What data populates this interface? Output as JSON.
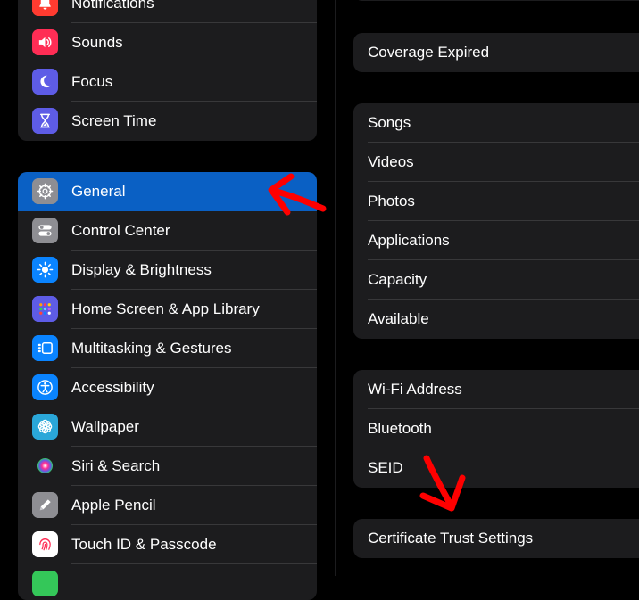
{
  "sidebar": {
    "group1": [
      {
        "label": "Notifications",
        "icon": "bell-icon",
        "color": "#ff3b30"
      },
      {
        "label": "Sounds",
        "icon": "speaker-icon",
        "color": "#ff2d55"
      },
      {
        "label": "Focus",
        "icon": "moon-icon",
        "color": "#5e5ce6"
      },
      {
        "label": "Screen Time",
        "icon": "hourglass-icon",
        "color": "#5e5ce6"
      }
    ],
    "group2": [
      {
        "label": "General",
        "icon": "gear-icon",
        "color": "#8e8e93",
        "selected": true
      },
      {
        "label": "Control Center",
        "icon": "toggles-icon",
        "color": "#8e8e93"
      },
      {
        "label": "Display & Brightness",
        "icon": "sun-icon",
        "color": "#0a84ff"
      },
      {
        "label": "Home Screen & App Library",
        "icon": "grid-icon",
        "color": "#5e5ce6"
      },
      {
        "label": "Multitasking & Gestures",
        "icon": "multitasking-icon",
        "color": "#0a84ff"
      },
      {
        "label": "Accessibility",
        "icon": "accessibility-icon",
        "color": "#0a84ff"
      },
      {
        "label": "Wallpaper",
        "icon": "flower-icon",
        "color": "#2aa7d9"
      },
      {
        "label": "Siri & Search",
        "icon": "siri-icon",
        "color": "#1c1c1e"
      },
      {
        "label": "Apple Pencil",
        "icon": "pencil-icon",
        "color": "#8e8e93"
      },
      {
        "label": "Touch ID & Passcode",
        "icon": "fingerprint-icon",
        "color": "#ffffff"
      },
      {
        "label": "",
        "icon": "battery-icon",
        "color": "#34c759"
      }
    ]
  },
  "detail": {
    "group_coverage": [
      "Coverage Expired"
    ],
    "group_media": [
      "Songs",
      "Videos",
      "Photos",
      "Applications",
      "Capacity",
      "Available"
    ],
    "group_network": [
      "Wi-Fi Address",
      "Bluetooth",
      "SEID"
    ],
    "group_certificate": [
      "Certificate Trust Settings"
    ]
  },
  "annotations": {
    "arrow_color": "#ff0000"
  }
}
